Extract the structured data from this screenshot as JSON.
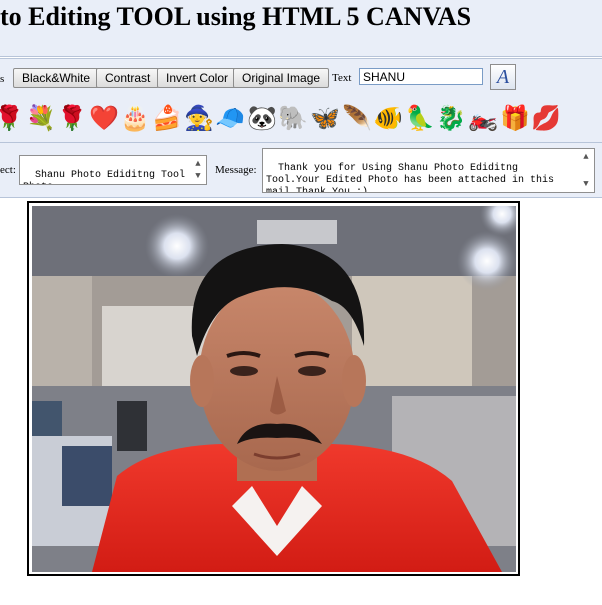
{
  "page": {
    "title": "to Editing TOOL using HTML 5 CANVAS"
  },
  "toolbar": {
    "cut_label": "s",
    "buttons": [
      "Black&White",
      "Contrast",
      "Invert Color",
      "Original Image"
    ],
    "text_label": "Text",
    "text_value": "SHANU",
    "font_glyph": "A"
  },
  "stickers": [
    {
      "icon": "rose-icon",
      "glyph": "🌹"
    },
    {
      "icon": "flower-bouquet-icon",
      "glyph": "💐"
    },
    {
      "icon": "red-rose-icon",
      "glyph": "🌹"
    },
    {
      "icon": "heart-icon",
      "glyph": "❤️"
    },
    {
      "icon": "birthday-cake-icon",
      "glyph": "🎂"
    },
    {
      "icon": "cake-icon",
      "glyph": "🍰"
    },
    {
      "icon": "wizard-hat-icon",
      "glyph": "🧙"
    },
    {
      "icon": "cap-icon",
      "glyph": "🧢"
    },
    {
      "icon": "panda-icon",
      "glyph": "🐼"
    },
    {
      "icon": "elephant-icon",
      "glyph": "🐘"
    },
    {
      "icon": "butterfly-icon",
      "glyph": "🦋"
    },
    {
      "icon": "feather-icon",
      "glyph": "🪶"
    },
    {
      "icon": "fish-icon",
      "glyph": "🐠"
    },
    {
      "icon": "parrot-icon",
      "glyph": "🦜"
    },
    {
      "icon": "dragon-icon",
      "glyph": "🐉"
    },
    {
      "icon": "motorbike-icon",
      "glyph": "🏍️"
    },
    {
      "icon": "gift-icon",
      "glyph": "🎁"
    },
    {
      "icon": "lips-icon",
      "glyph": "💋"
    }
  ],
  "mail": {
    "subject_label": "ect:",
    "subject_value": "Shanu Photo Ediditng Tool Photo",
    "message_label": "Message:",
    "message_value": "Thank you for Using Shanu Photo Ediditng Tool.Your Edited Photo has been attached in this mail.Thank You :)"
  },
  "colors": {
    "panel_bg": "#e9eef8",
    "shirt_red": "#e0261c"
  }
}
